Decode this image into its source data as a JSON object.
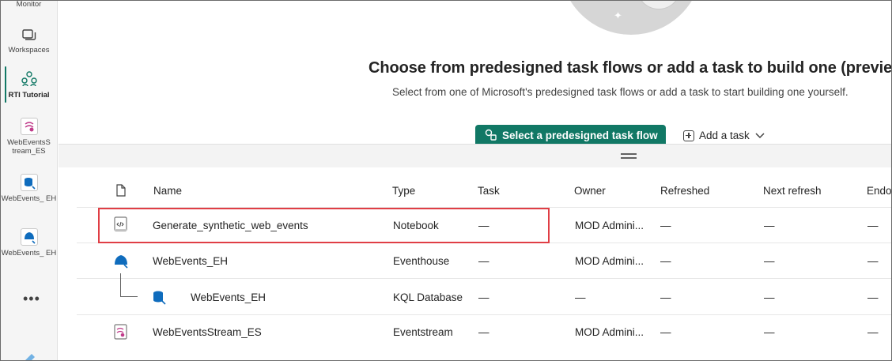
{
  "nav": {
    "items": [
      {
        "label": "Monitor",
        "icon": "monitor-icon"
      },
      {
        "label": "Workspaces",
        "icon": "workspaces-icon"
      },
      {
        "label": "RTI Tutorial",
        "icon": "workspace-group-icon",
        "active": true
      },
      {
        "label": "WebEventsS tream_ES",
        "icon": "eventstream-icon"
      },
      {
        "label": "WebEvents_ EH",
        "icon": "kql-database-icon"
      },
      {
        "label": "WebEvents_ EH",
        "icon": "eventhouse-icon"
      }
    ],
    "more_label": "•••"
  },
  "hero": {
    "title": "Choose from predesigned task flows or add a task to build one (preview)",
    "subtitle": "Select from one of Microsoft's predesigned task flows or add a task to start building one yourself.",
    "primary_button": "Select a predesigned task flow",
    "add_task_label": "Add a task"
  },
  "table": {
    "columns": [
      "Name",
      "Type",
      "Task",
      "Owner",
      "Refreshed",
      "Next refresh",
      "Endo"
    ],
    "rows": [
      {
        "name": "Generate_synthetic_web_events",
        "type": "Notebook",
        "task": "—",
        "owner": "MOD Admini...",
        "refreshed": "—",
        "next_refresh": "—",
        "endo": "—",
        "icon": "notebook-icon",
        "highlighted": true
      },
      {
        "name": "WebEvents_EH",
        "type": "Eventhouse",
        "task": "—",
        "owner": "MOD Admini...",
        "refreshed": "—",
        "next_refresh": "—",
        "endo": "—",
        "icon": "eventhouse-icon"
      },
      {
        "name": "WebEvents_EH",
        "type": "KQL Database",
        "task": "—",
        "owner": "—",
        "refreshed": "—",
        "next_refresh": "—",
        "endo": "—",
        "icon": "kql-database-icon",
        "child": true
      },
      {
        "name": "WebEventsStream_ES",
        "type": "Eventstream",
        "task": "—",
        "owner": "MOD Admini...",
        "refreshed": "—",
        "next_refresh": "—",
        "endo": "—",
        "icon": "eventstream-icon"
      }
    ]
  },
  "colors": {
    "accent": "#117865",
    "highlight": "#e03e45"
  }
}
